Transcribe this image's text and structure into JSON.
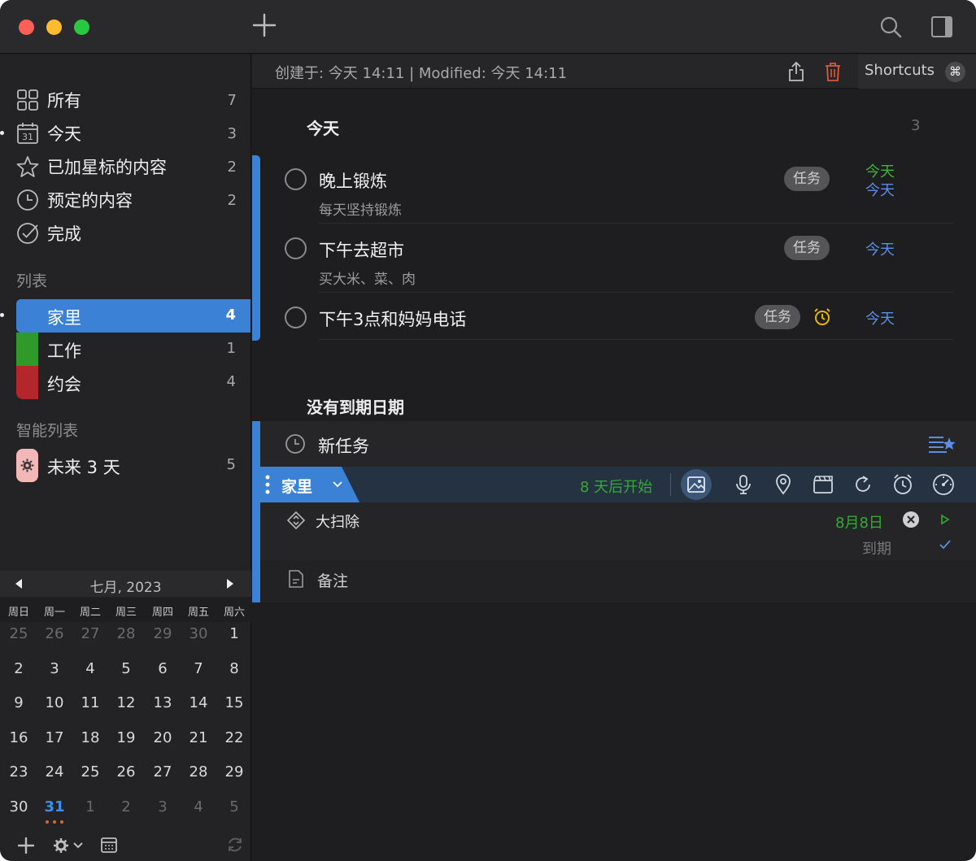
{
  "titlebar": {
    "add_icon": "plus-icon",
    "search_icon": "search-icon",
    "sidebar_icon": "sidebar-toggle-icon"
  },
  "sidebar": {
    "smart": [
      {
        "label": "所有",
        "count": "7",
        "icon": "grid-icon"
      },
      {
        "label": "今天",
        "count": "3",
        "icon": "calendar-31-icon"
      },
      {
        "label": "已加星标的内容",
        "count": "2",
        "icon": "star-icon"
      },
      {
        "label": "预定的内容",
        "count": "2",
        "icon": "clock-icon"
      },
      {
        "label": "完成",
        "count": "",
        "icon": "checkmark-circle-icon"
      }
    ],
    "lists_header": "列表",
    "lists": [
      {
        "label": "家里",
        "count": "4",
        "color": "#3b82d6"
      },
      {
        "label": "工作",
        "count": "1",
        "color": "#2f9a2a"
      },
      {
        "label": "约会",
        "count": "4",
        "color": "#b3262b"
      }
    ],
    "smart_lists_header": "智能列表",
    "smart_lists": [
      {
        "label": "未来 3 天",
        "count": "5",
        "color": "#f3b7b7"
      }
    ]
  },
  "calendar": {
    "title": "七月, 2023",
    "dow": [
      "周日",
      "周一",
      "周二",
      "周三",
      "周四",
      "周五",
      "周六"
    ],
    "weeks": [
      [
        "25",
        "26",
        "27",
        "28",
        "29",
        "30",
        "1"
      ],
      [
        "2",
        "3",
        "4",
        "5",
        "6",
        "7",
        "8"
      ],
      [
        "9",
        "10",
        "11",
        "12",
        "13",
        "14",
        "15"
      ],
      [
        "16",
        "17",
        "18",
        "19",
        "20",
        "21",
        "22"
      ],
      [
        "23",
        "24",
        "25",
        "26",
        "27",
        "28",
        "29"
      ],
      [
        "30",
        "31",
        "1",
        "2",
        "3",
        "4",
        "5"
      ]
    ],
    "today": "31"
  },
  "meta": {
    "text": "创建于: 今天 14:11  |  Modified: 今天 14:11",
    "shortcuts_label": "Shortcuts",
    "shortcut_symbol": "⌘"
  },
  "groups": {
    "today": {
      "title": "今天",
      "count": "3"
    },
    "no_due": {
      "title": "没有到期日期"
    }
  },
  "tasks": [
    {
      "title": "晚上锻炼",
      "note": "每天坚持锻炼",
      "tag": "任务",
      "date_top": "今天",
      "date_bottom": "今天"
    },
    {
      "title": "下午去超市",
      "note": "买大米、菜、肉",
      "tag": "任务",
      "date": "今天"
    },
    {
      "title": "下午3点和妈妈电话",
      "tag": "任务",
      "date": "今天",
      "has_alarm": true
    }
  ],
  "new_task": {
    "title": "新任务",
    "list_name": "家里",
    "start_text": "8 天后开始",
    "subtask": "大扫除",
    "subtask_date": "8月8日",
    "due_label": "到期",
    "note_label": "备注"
  }
}
